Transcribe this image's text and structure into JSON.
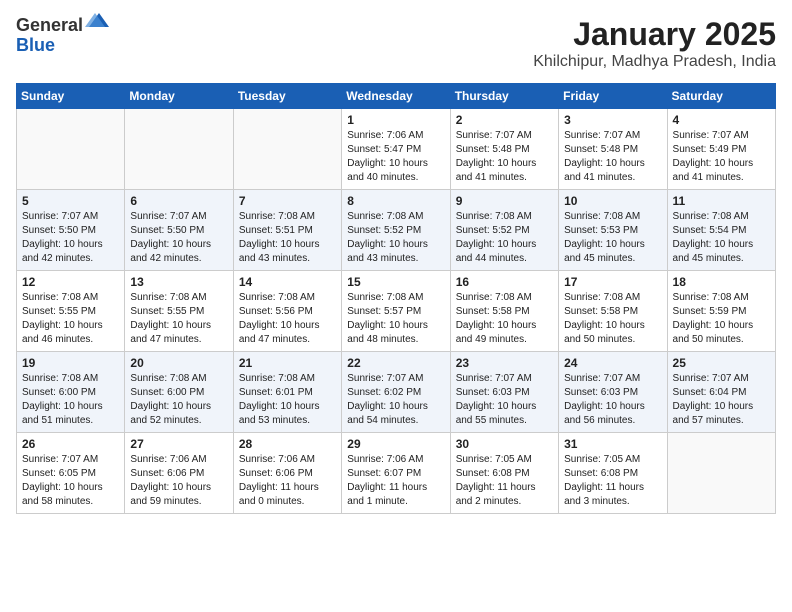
{
  "header": {
    "logo_general": "General",
    "logo_blue": "Blue",
    "month": "January 2025",
    "location": "Khilchipur, Madhya Pradesh, India"
  },
  "weekdays": [
    "Sunday",
    "Monday",
    "Tuesday",
    "Wednesday",
    "Thursday",
    "Friday",
    "Saturday"
  ],
  "weeks": [
    [
      {
        "day": "",
        "info": ""
      },
      {
        "day": "",
        "info": ""
      },
      {
        "day": "",
        "info": ""
      },
      {
        "day": "1",
        "info": "Sunrise: 7:06 AM\nSunset: 5:47 PM\nDaylight: 10 hours\nand 40 minutes."
      },
      {
        "day": "2",
        "info": "Sunrise: 7:07 AM\nSunset: 5:48 PM\nDaylight: 10 hours\nand 41 minutes."
      },
      {
        "day": "3",
        "info": "Sunrise: 7:07 AM\nSunset: 5:48 PM\nDaylight: 10 hours\nand 41 minutes."
      },
      {
        "day": "4",
        "info": "Sunrise: 7:07 AM\nSunset: 5:49 PM\nDaylight: 10 hours\nand 41 minutes."
      }
    ],
    [
      {
        "day": "5",
        "info": "Sunrise: 7:07 AM\nSunset: 5:50 PM\nDaylight: 10 hours\nand 42 minutes."
      },
      {
        "day": "6",
        "info": "Sunrise: 7:07 AM\nSunset: 5:50 PM\nDaylight: 10 hours\nand 42 minutes."
      },
      {
        "day": "7",
        "info": "Sunrise: 7:08 AM\nSunset: 5:51 PM\nDaylight: 10 hours\nand 43 minutes."
      },
      {
        "day": "8",
        "info": "Sunrise: 7:08 AM\nSunset: 5:52 PM\nDaylight: 10 hours\nand 43 minutes."
      },
      {
        "day": "9",
        "info": "Sunrise: 7:08 AM\nSunset: 5:52 PM\nDaylight: 10 hours\nand 44 minutes."
      },
      {
        "day": "10",
        "info": "Sunrise: 7:08 AM\nSunset: 5:53 PM\nDaylight: 10 hours\nand 45 minutes."
      },
      {
        "day": "11",
        "info": "Sunrise: 7:08 AM\nSunset: 5:54 PM\nDaylight: 10 hours\nand 45 minutes."
      }
    ],
    [
      {
        "day": "12",
        "info": "Sunrise: 7:08 AM\nSunset: 5:55 PM\nDaylight: 10 hours\nand 46 minutes."
      },
      {
        "day": "13",
        "info": "Sunrise: 7:08 AM\nSunset: 5:55 PM\nDaylight: 10 hours\nand 47 minutes."
      },
      {
        "day": "14",
        "info": "Sunrise: 7:08 AM\nSunset: 5:56 PM\nDaylight: 10 hours\nand 47 minutes."
      },
      {
        "day": "15",
        "info": "Sunrise: 7:08 AM\nSunset: 5:57 PM\nDaylight: 10 hours\nand 48 minutes."
      },
      {
        "day": "16",
        "info": "Sunrise: 7:08 AM\nSunset: 5:58 PM\nDaylight: 10 hours\nand 49 minutes."
      },
      {
        "day": "17",
        "info": "Sunrise: 7:08 AM\nSunset: 5:58 PM\nDaylight: 10 hours\nand 50 minutes."
      },
      {
        "day": "18",
        "info": "Sunrise: 7:08 AM\nSunset: 5:59 PM\nDaylight: 10 hours\nand 50 minutes."
      }
    ],
    [
      {
        "day": "19",
        "info": "Sunrise: 7:08 AM\nSunset: 6:00 PM\nDaylight: 10 hours\nand 51 minutes."
      },
      {
        "day": "20",
        "info": "Sunrise: 7:08 AM\nSunset: 6:00 PM\nDaylight: 10 hours\nand 52 minutes."
      },
      {
        "day": "21",
        "info": "Sunrise: 7:08 AM\nSunset: 6:01 PM\nDaylight: 10 hours\nand 53 minutes."
      },
      {
        "day": "22",
        "info": "Sunrise: 7:07 AM\nSunset: 6:02 PM\nDaylight: 10 hours\nand 54 minutes."
      },
      {
        "day": "23",
        "info": "Sunrise: 7:07 AM\nSunset: 6:03 PM\nDaylight: 10 hours\nand 55 minutes."
      },
      {
        "day": "24",
        "info": "Sunrise: 7:07 AM\nSunset: 6:03 PM\nDaylight: 10 hours\nand 56 minutes."
      },
      {
        "day": "25",
        "info": "Sunrise: 7:07 AM\nSunset: 6:04 PM\nDaylight: 10 hours\nand 57 minutes."
      }
    ],
    [
      {
        "day": "26",
        "info": "Sunrise: 7:07 AM\nSunset: 6:05 PM\nDaylight: 10 hours\nand 58 minutes."
      },
      {
        "day": "27",
        "info": "Sunrise: 7:06 AM\nSunset: 6:06 PM\nDaylight: 10 hours\nand 59 minutes."
      },
      {
        "day": "28",
        "info": "Sunrise: 7:06 AM\nSunset: 6:06 PM\nDaylight: 11 hours\nand 0 minutes."
      },
      {
        "day": "29",
        "info": "Sunrise: 7:06 AM\nSunset: 6:07 PM\nDaylight: 11 hours\nand 1 minute."
      },
      {
        "day": "30",
        "info": "Sunrise: 7:05 AM\nSunset: 6:08 PM\nDaylight: 11 hours\nand 2 minutes."
      },
      {
        "day": "31",
        "info": "Sunrise: 7:05 AM\nSunset: 6:08 PM\nDaylight: 11 hours\nand 3 minutes."
      },
      {
        "day": "",
        "info": ""
      }
    ]
  ]
}
